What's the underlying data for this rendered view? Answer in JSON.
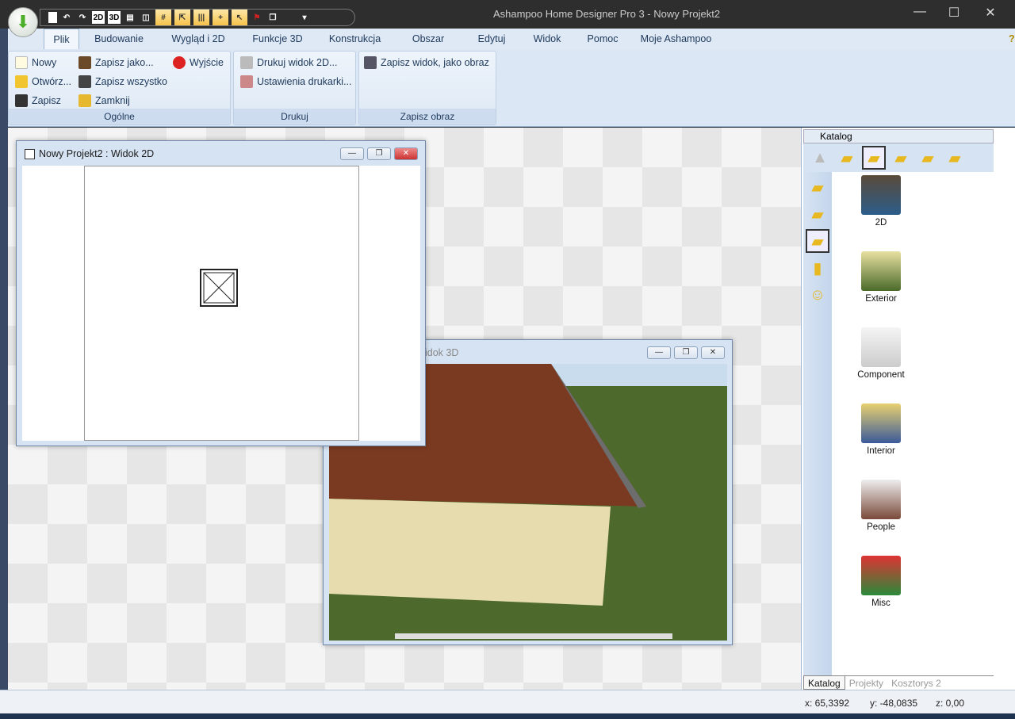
{
  "window": {
    "title": "Ashampoo Home Designer Pro 3 - Nowy Projekt2",
    "minimize": "—",
    "maximize": "☐",
    "close": "✕"
  },
  "qat": [
    {
      "icon": "new-icon",
      "label": ""
    },
    {
      "icon": "undo-icon",
      "label": "↶"
    },
    {
      "icon": "redo-icon",
      "label": "↷"
    },
    {
      "icon": "view-2d-icon",
      "label": "2D"
    },
    {
      "icon": "view-3d-icon",
      "label": "3D"
    },
    {
      "icon": "split-horizontal-icon",
      "label": "▤"
    },
    {
      "icon": "split-vertical-icon",
      "label": "◫"
    },
    {
      "icon": "grid-icon",
      "label": "#"
    },
    {
      "icon": "select-icon",
      "label": "⇱"
    },
    {
      "icon": "columns-icon",
      "label": "|||"
    },
    {
      "icon": "snap-icon",
      "label": "+"
    },
    {
      "icon": "pointer-icon",
      "label": "↖"
    },
    {
      "icon": "flag-icon",
      "label": "⚑"
    },
    {
      "icon": "copy-icon",
      "label": "❐"
    },
    {
      "icon": "customize-icon",
      "label": "▾"
    }
  ],
  "tabs": [
    "Plik",
    "Budowanie",
    "Wygląd i 2D",
    "Funkcje 3D",
    "Konstrukcja",
    "Obszar",
    "Edytuj",
    "Widok",
    "Pomoc",
    "Moje Ashampoo"
  ],
  "help": "?",
  "ribbon": {
    "ogolne": {
      "label": "Ogólne",
      "items": [
        "Nowy",
        "Otwórz...",
        "Zapisz",
        "Zapisz jako...",
        "Zapisz wszystko",
        "Zamknij",
        "Wyjście"
      ]
    },
    "drukuj": {
      "label": "Drukuj",
      "items": [
        "Drukuj widok 2D...",
        "Ustawienia drukarki..."
      ]
    },
    "zapisz_obraz": {
      "label": "Zapisz obraz",
      "items": [
        "Zapisz widok, jako obraz"
      ]
    }
  },
  "win2d": {
    "title": "Nowy Projekt2 : Widok 2D"
  },
  "win3d": {
    "title": "idok 3D"
  },
  "catalog": {
    "title": "Katalog",
    "items": [
      "2D",
      "Exterior",
      "Component",
      "Interior",
      "People",
      "Misc"
    ],
    "tabs": [
      "Katalog",
      "Projekty",
      "Kosztorys 2"
    ]
  },
  "status": {
    "x": "x: 65,3392",
    "y": "y: -48,0835",
    "z": "z: 0,00"
  },
  "colors": {
    "roof": "#7a3a22",
    "wall": "#e6dcae",
    "grass": "#4d6a2c",
    "sky": "#c9dcee"
  }
}
